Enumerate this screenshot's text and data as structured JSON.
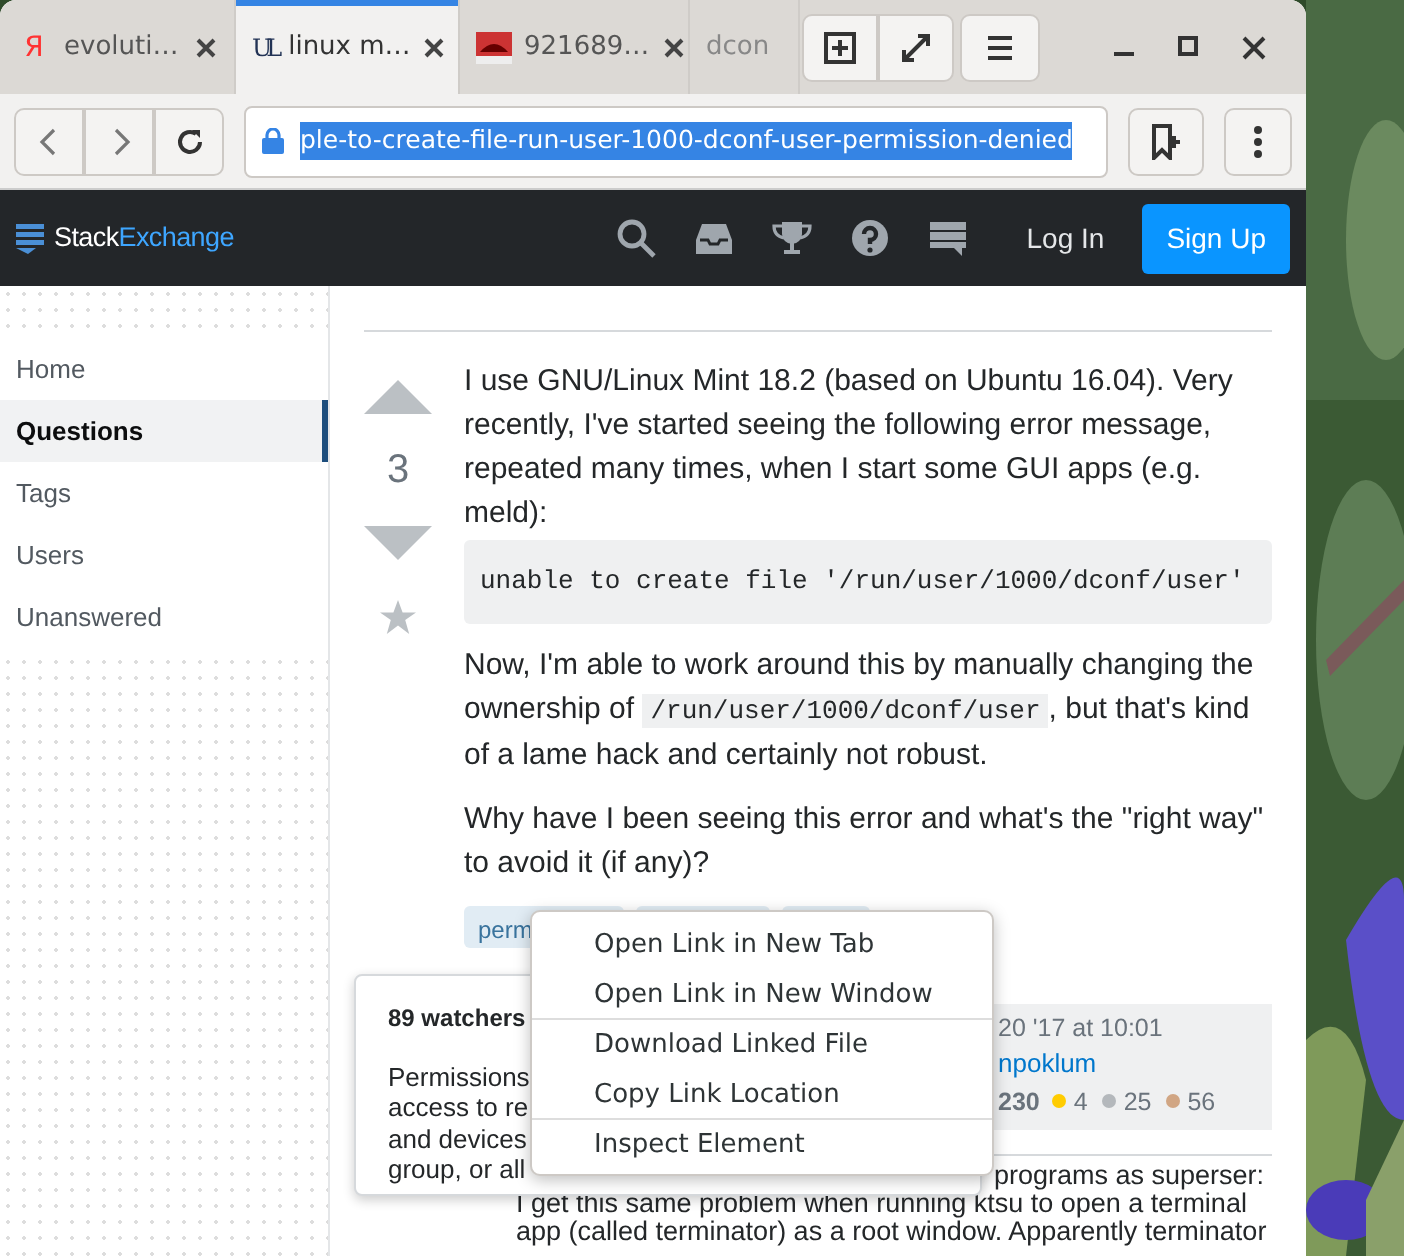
{
  "browser": {
    "tabs": [
      {
        "title": "evoluti…",
        "favicon": "Я",
        "selected": false,
        "closable": true
      },
      {
        "title": "linux m…",
        "favicon": "UL",
        "selected": true,
        "closable": true
      },
      {
        "title": "921689…",
        "selected": false,
        "closable": true
      },
      {
        "title": "dcon",
        "selected": false,
        "closable": false
      }
    ],
    "address": {
      "text": "ple-to-create-file-run-user-1000-dconf-user-permission-denied",
      "selected": true
    }
  },
  "site": {
    "logo": {
      "first": "Stack",
      "second": "Exchange"
    },
    "login": "Log In",
    "signup": "Sign Up"
  },
  "sidebar": {
    "items": [
      {
        "label": "Home",
        "selected": false
      },
      {
        "label": "Questions",
        "selected": true
      },
      {
        "label": "Tags",
        "selected": false
      },
      {
        "label": "Users",
        "selected": false
      },
      {
        "label": "Unanswered",
        "selected": false
      }
    ]
  },
  "question": {
    "votes": "3",
    "body": [
      {
        "kind": "text",
        "parts": [
          {
            "text": "I use GNU/Linux Mint 18.2 (based on Ubuntu 16.04). Very recently, I've started seeing the following error message, repeated many times, when I start some GUI apps (e.g. meld):"
          }
        ]
      },
      {
        "kind": "code",
        "parts": [
          {
            "text": "unable to create file '/run/user/1000/dconf/user'"
          }
        ]
      },
      {
        "kind": "text",
        "parts": [
          {
            "text": "Now, I'm able to work around this by manually changing the ownership of "
          },
          {
            "code": "/run/user/1000/dconf/user"
          },
          {
            "text": ", but that's kind of a lame hack and certainly not robust."
          }
        ]
      },
      {
        "kind": "text",
        "parts": [
          {
            "text": "Why have I been seeing this error and what's the \"right way\" to avoid it (if any)?"
          }
        ]
      }
    ],
    "tags": [
      {
        "kind": "label",
        "label": "perm"
      },
      {
        "kind": "covered"
      },
      {
        "kind": "covered"
      }
    ],
    "owner": {
      "date": "20 '17 at 10:01",
      "user": "npoklum",
      "reputation": "230",
      "badges": [
        {
          "count": "4",
          "color": "#ffcc01"
        },
        {
          "count": "25",
          "color": "#b4b8bc"
        },
        {
          "count": "56",
          "color": "#d1a684"
        }
      ]
    },
    "comment_lines": [
      "programs as superser:",
      "I get this same problem when running ktsu to open a terminal",
      "app (called terminator) as a root window. Apparently terminator"
    ]
  },
  "tag_popover": {
    "title": "89 watchers",
    "lines": [
      "Permissions",
      "access to re",
      "and devices",
      "group, or all"
    ]
  },
  "context_menu": {
    "items": [
      {
        "label": "Open Link in New Tab",
        "divider_before": false
      },
      {
        "label": "Open Link in New Window",
        "divider_before": false
      },
      {
        "label": "Download Linked File",
        "divider_before": true
      },
      {
        "label": "Copy Link Location",
        "divider_before": false
      },
      {
        "label": "Inspect Element",
        "divider_before": true
      }
    ]
  }
}
